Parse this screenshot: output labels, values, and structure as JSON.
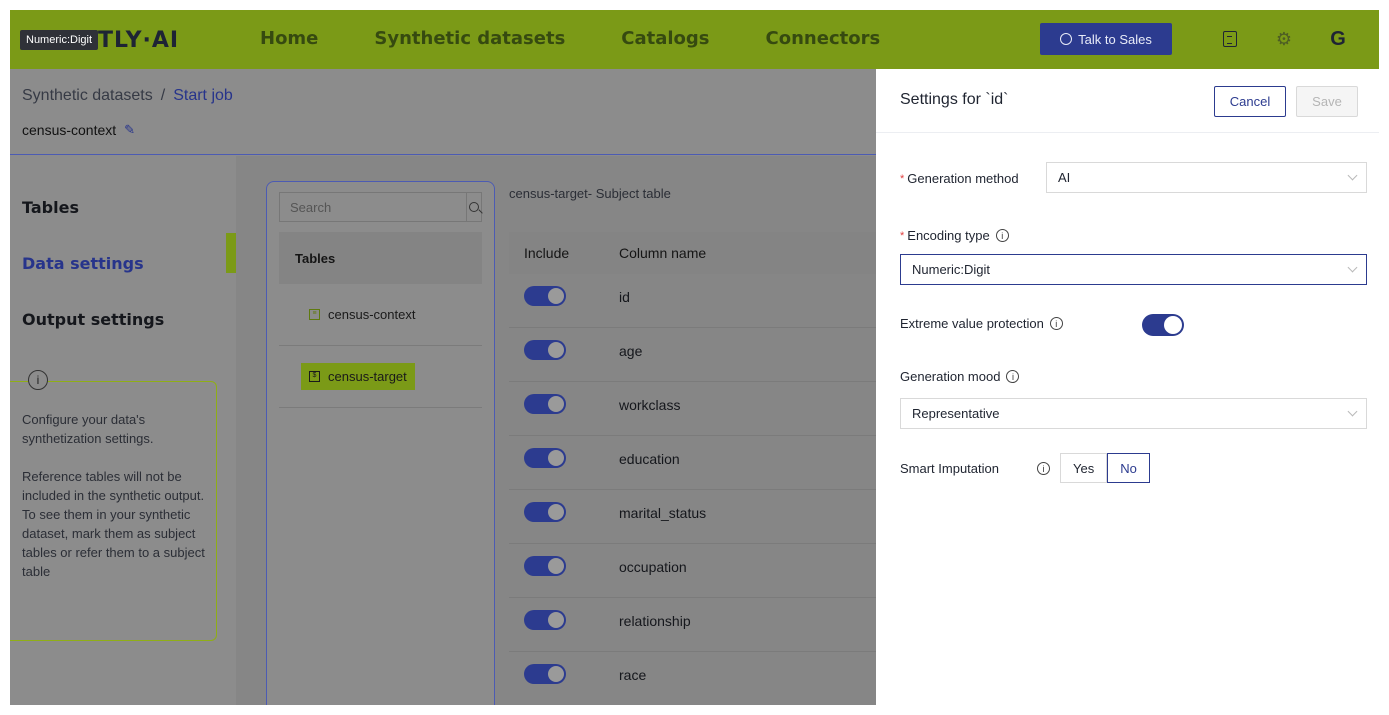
{
  "topbar": {
    "logo_badge": "Numeric:Digit",
    "logo_text": "TLY·AI",
    "nav": [
      "Home",
      "Synthetic datasets",
      "Catalogs",
      "Connectors"
    ],
    "talk_to_sales": "Talk to Sales"
  },
  "breadcrumb": {
    "parent": "Synthetic datasets",
    "separator": "/",
    "current": "Start job"
  },
  "dataset_name": "census-context",
  "sidebar": {
    "items": [
      "Tables",
      "Data settings",
      "Output settings"
    ],
    "active": "Data settings",
    "info_paragraph_1": "Configure your data's synthetization settings.",
    "info_paragraph_2": "Reference tables will not be included in the synthetic output. To see them in your synthetic dataset, mark them as subject tables or refer them to a subject table"
  },
  "tables_panel": {
    "search_placeholder": "Search",
    "header": "Tables",
    "tables": [
      "census-context",
      "census-target"
    ],
    "selected": "census-target"
  },
  "columns_panel": {
    "title": "census-target- Subject table",
    "header_include": "Include",
    "header_column_name": "Column name",
    "columns": [
      "id",
      "age",
      "workclass",
      "education",
      "marital_status",
      "occupation",
      "relationship",
      "race"
    ]
  },
  "drawer": {
    "title": "Settings for `id`",
    "cancel_label": "Cancel",
    "save_label": "Save",
    "generation_method_label": "Generation method",
    "generation_method_value": "AI",
    "encoding_type_label": "Encoding type",
    "encoding_type_value": "Numeric:Digit",
    "extreme_value_label": "Extreme value protection",
    "extreme_value_enabled": true,
    "generation_mood_label": "Generation mood",
    "generation_mood_value": "Representative",
    "smart_imputation_label": "Smart Imputation",
    "smart_imputation_options": [
      "Yes",
      "No"
    ],
    "smart_imputation_selected": "No"
  },
  "colors": {
    "brand_green": "#7b9a17",
    "accent_blue": "#2c3b8f"
  }
}
